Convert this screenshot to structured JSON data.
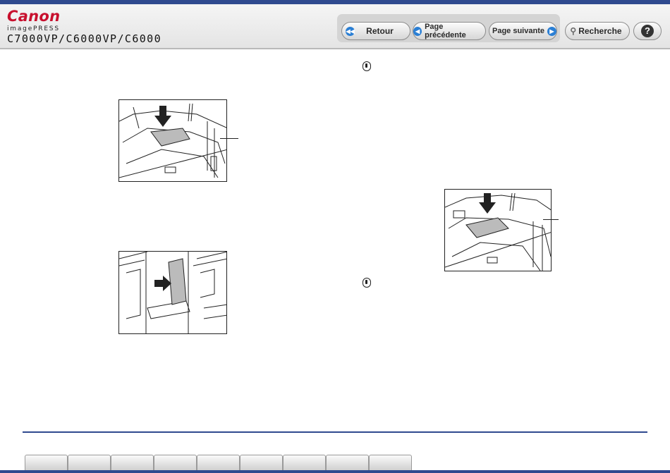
{
  "brand": {
    "logo": "Canon",
    "product": "imagePRESS",
    "model": "C7000VP/C6000VP/C6000"
  },
  "nav": {
    "back": "Retour",
    "prev": "Page précédente",
    "next": "Page suivante",
    "search": "Recherche",
    "help": "?"
  },
  "icons": {
    "back": "rewind-icon",
    "prev": "arrow-left-icon",
    "next": "arrow-right-icon",
    "search": "magnifier-icon",
    "help": "question-icon",
    "note": "note-icon"
  },
  "colors": {
    "accent": "#2f4a8f",
    "logo": "#c8102e",
    "nav_icon": "#2b7fd4"
  },
  "tabs": [
    "",
    "",
    "",
    "",
    "",
    "",
    "",
    "",
    ""
  ]
}
